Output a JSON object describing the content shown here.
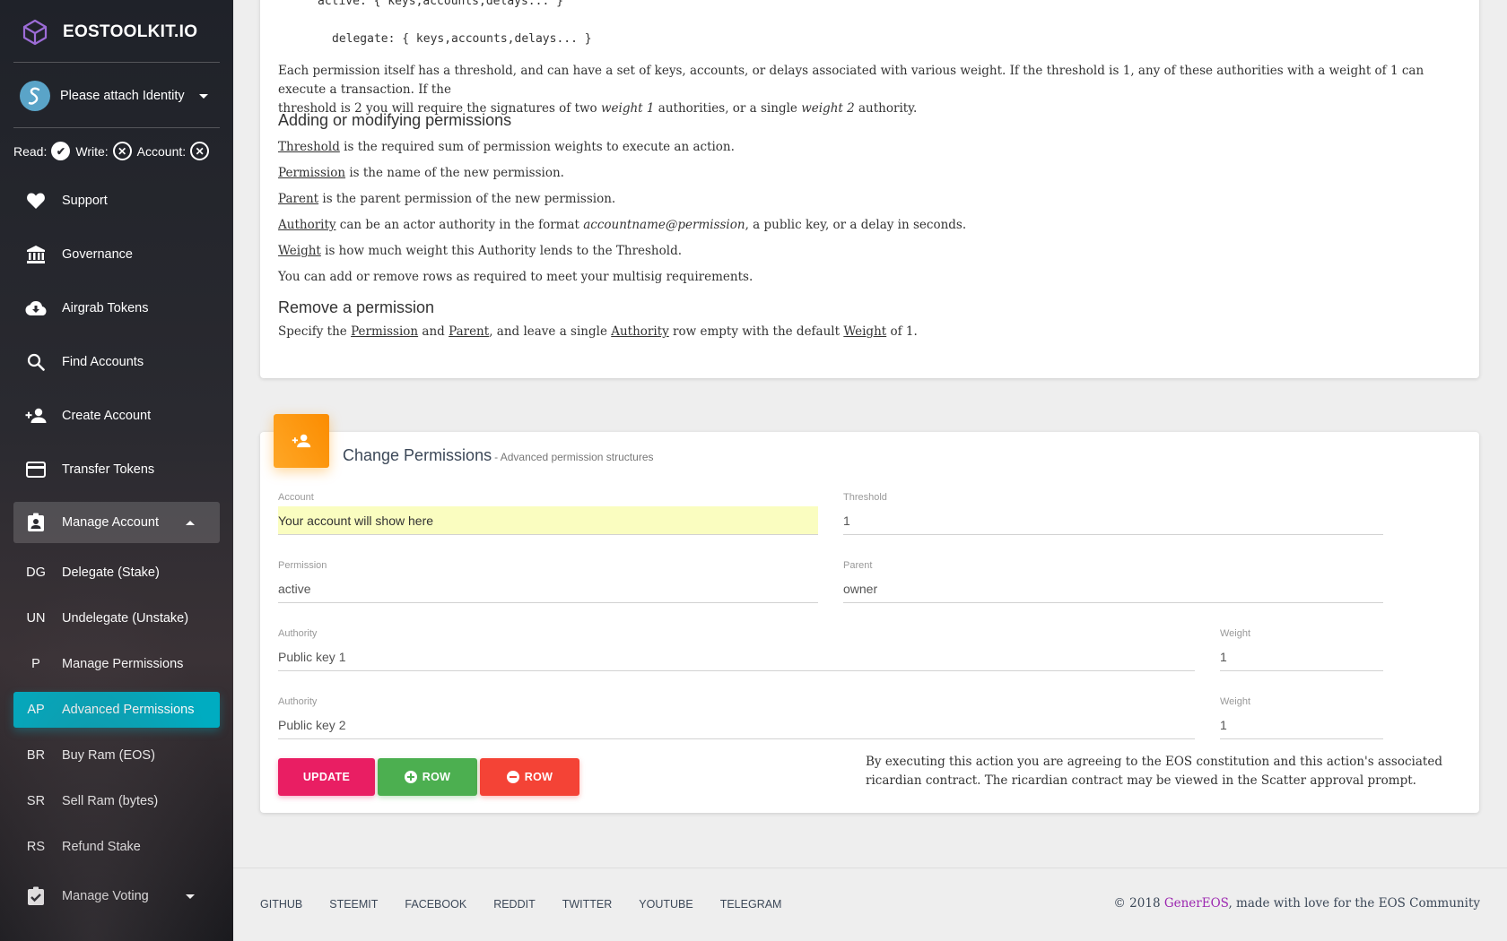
{
  "sidebar": {
    "logo_text": "EOSTOOLKIT.IO",
    "identity_label": "Please attach Identity",
    "status": {
      "read": "Read:",
      "write": "Write:",
      "account": "Account:"
    },
    "nav": [
      {
        "label": "Support",
        "icon": "heart-icon"
      },
      {
        "label": "Governance",
        "icon": "bank-icon"
      },
      {
        "label": "Airgrab Tokens",
        "icon": "cloud-download-icon"
      },
      {
        "label": "Find Accounts",
        "icon": "search-icon"
      },
      {
        "label": "Create Account",
        "icon": "person-add-icon"
      },
      {
        "label": "Transfer Tokens",
        "icon": "credit-card-icon"
      },
      {
        "label": "Manage Account",
        "icon": "contact-badge-icon"
      }
    ],
    "sub": [
      {
        "abbr": "DG",
        "label": "Delegate (Stake)"
      },
      {
        "abbr": "UN",
        "label": "Undelegate (Unstake)"
      },
      {
        "abbr": "P",
        "label": "Manage Permissions"
      },
      {
        "abbr": "AP",
        "label": "Advanced Permissions"
      },
      {
        "abbr": "BR",
        "label": "Buy Ram (EOS)"
      },
      {
        "abbr": "SR",
        "label": "Sell Ram (bytes)"
      },
      {
        "abbr": "RS",
        "label": "Refund Stake"
      }
    ],
    "voting": {
      "label": "Manage Voting",
      "icon": "clipboard-check-icon"
    }
  },
  "docs": {
    "code_active": "active: { keys,accounts,delays... }",
    "code_delegate": "delegate: { keys,accounts,delays... }",
    "threshold_para_1": "Each permission itself has a threshold, and can have a set of keys, accounts, or delays associated with various weight. If the threshold is 1, any of these authorities with a weight of 1 can execute a transaction. If the",
    "threshold_para_2a": "threshold is 2 you will require the signatures of two ",
    "threshold_para_2b": "weight 1",
    "threshold_para_2c": " authorities, or a single ",
    "threshold_para_2d": "weight 2",
    "threshold_para_2e": " authority.",
    "heading_add": "Adding or modifying permissions",
    "term_threshold": "Threshold",
    "desc_threshold": " is the required sum of permission weights to execute an action.",
    "term_permission": "Permission",
    "desc_permission": " is the name of the new permission.",
    "term_parent": "Parent",
    "desc_parent": " is the parent permission of the new permission.",
    "term_authority": "Authority",
    "desc_authority_a": " can be an actor authority in the format ",
    "desc_authority_b": "accountname@permission",
    "desc_authority_c": ", a public key, or a delay in seconds.",
    "term_weight": "Weight",
    "desc_weight": " is how much weight this Authority lends to the Threshold.",
    "rows_note": "You can add or remove rows as required to meet your multisig requirements.",
    "heading_remove": "Remove a permission",
    "remove_a": "Specify the ",
    "remove_b": "Permission",
    "remove_c": " and ",
    "remove_d": "Parent",
    "remove_e": ", and leave a single ",
    "remove_f": "Authority",
    "remove_g": " row empty with the default ",
    "remove_h": "Weight",
    "remove_i": " of 1."
  },
  "form": {
    "title": "Change Permissions",
    "subtitle": "- Advanced permission structures",
    "account_label": "Account",
    "account_value": "Your account will show here",
    "threshold_label": "Threshold",
    "threshold_value": "1",
    "permission_label": "Permission",
    "permission_value": "active",
    "parent_label": "Parent",
    "parent_value": "owner",
    "authority_rows": [
      {
        "label": "Authority",
        "value": "Public key 1",
        "weight_label": "Weight",
        "weight": "1"
      },
      {
        "label": "Authority",
        "value": "Public key 2",
        "weight_label": "Weight",
        "weight": "1"
      }
    ],
    "btn_update": "UPDATE",
    "btn_add_row": "ROW",
    "btn_remove_row": "ROW",
    "disclaimer": "By executing this action you are agreeing to the EOS constitution and this action's associated ricardian contract. The ricardian contract may be viewed in the Scatter approval prompt."
  },
  "footer": {
    "links": [
      "GITHUB",
      "STEEMIT",
      "FACEBOOK",
      "REDDIT",
      "TWITTER",
      "YOUTUBE",
      "TELEGRAM"
    ],
    "copyright_prefix": "© 2018 ",
    "copyright_brand": "GenerEOS",
    "copyright_suffix": ", made with love for the EOS Community"
  },
  "colors": {
    "active_nav": "#00acc1",
    "update_button": "#e91e63",
    "add_button": "#4caf50",
    "remove_button": "#f44336",
    "card_icon": "#fb8c00",
    "brand_link": "#9c27b0",
    "account_highlight": "#fafdc0"
  }
}
